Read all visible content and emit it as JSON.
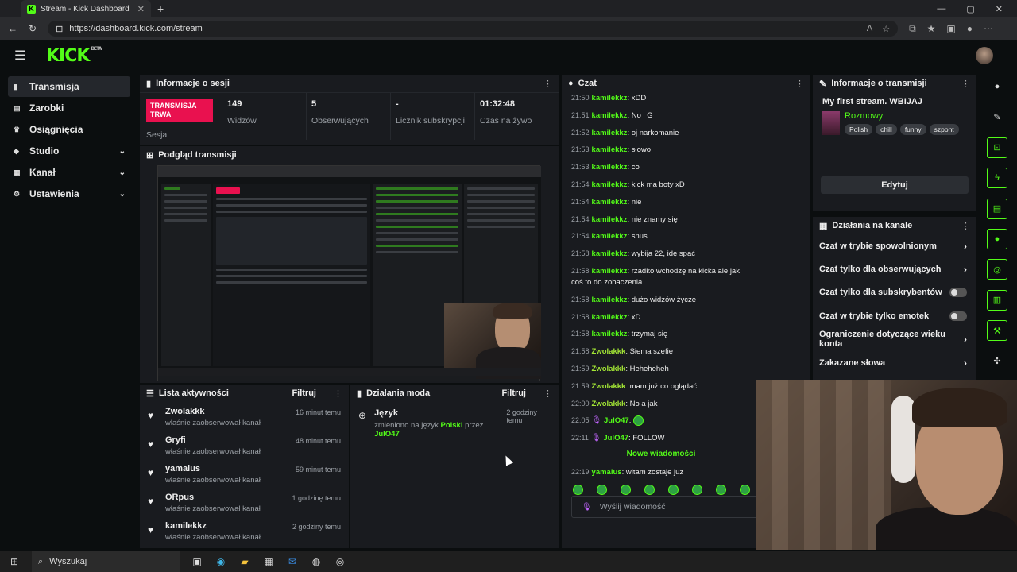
{
  "browser": {
    "tab_title": "Stream - Kick Dashboard",
    "url": "https://dashboard.kick.com/stream",
    "tab_logo": "K"
  },
  "site": {
    "logo": "KICK",
    "beta": "BETA"
  },
  "sidebar": {
    "items": [
      {
        "label": "Transmisja",
        "icon": "broadcast-icon",
        "active": true
      },
      {
        "label": "Zarobki",
        "icon": "earnings-icon"
      },
      {
        "label": "Osiągnięcia",
        "icon": "trophy-icon"
      },
      {
        "label": "Studio",
        "icon": "studio-icon",
        "chevron": true
      },
      {
        "label": "Kanał",
        "icon": "channel-icon",
        "chevron": true
      },
      {
        "label": "Ustawienia",
        "icon": "gear-icon",
        "chevron": true
      }
    ]
  },
  "session": {
    "title": "Informacje o sesji",
    "live_badge": "TRANSMISJA TRWA",
    "live_label": "Sesja",
    "stats": [
      {
        "value": "149",
        "label": "Widzów"
      },
      {
        "value": "5",
        "label": "Obserwujących"
      },
      {
        "value": "-",
        "label": "Licznik subskrypcji"
      },
      {
        "value": "01:32:48",
        "label": "Czas na żywo"
      }
    ]
  },
  "preview": {
    "title": "Podgląd transmisji"
  },
  "activity": {
    "title": "Lista aktywności",
    "filter": "Filtruj",
    "items": [
      {
        "name": "Zwolakkk",
        "desc": "właśnie zaobserwował kanał",
        "time": "16 minut temu"
      },
      {
        "name": "Gryfi",
        "desc": "właśnie zaobserwował kanał",
        "time": "48 minut temu"
      },
      {
        "name": "yamalus",
        "desc": "właśnie zaobserwował kanał",
        "time": "59 minut temu"
      },
      {
        "name": "ORpus",
        "desc": "właśnie zaobserwował kanał",
        "time": "1 godzinę temu"
      },
      {
        "name": "kamilekkz",
        "desc": "właśnie zaobserwował kanał",
        "time": "2 godziny temu"
      }
    ]
  },
  "mod": {
    "title": "Działania moda",
    "filter": "Filtruj",
    "items": [
      {
        "name": "Język",
        "desc_pre": "zmieniono na język",
        "lang": "Polski",
        "by": "przez",
        "user": "JulO47",
        "time": "2 godziny temu"
      }
    ]
  },
  "chat": {
    "title": "Czat",
    "messages": [
      {
        "time": "21:50",
        "user": "kamilekkz",
        "text": "xDD"
      },
      {
        "time": "21:51",
        "user": "kamilekkz",
        "text": "No i G"
      },
      {
        "time": "21:52",
        "user": "kamilekkz",
        "text": "oj narkomanie"
      },
      {
        "time": "21:53",
        "user": "kamilekkz",
        "text": "słowo"
      },
      {
        "time": "21:53",
        "user": "kamilekkz",
        "text": "co"
      },
      {
        "time": "21:54",
        "user": "kamilekkz",
        "text": "kick ma boty xD"
      },
      {
        "time": "21:54",
        "user": "kamilekkz",
        "text": "nie"
      },
      {
        "time": "21:54",
        "user": "kamilekkz",
        "text": "nie znamy się"
      },
      {
        "time": "21:54",
        "user": "kamilekkz",
        "text": "snus"
      },
      {
        "time": "21:58",
        "user": "kamilekkz",
        "text": "wybija 22, idę spać"
      },
      {
        "time": "21:58",
        "user": "kamilekkz",
        "text": "rzadko wchodzę na kicka ale jak coś to do zobaczenia"
      },
      {
        "time": "21:58",
        "user": "kamilekkz",
        "text": "dużo widzów życze"
      },
      {
        "time": "21:58",
        "user": "kamilekkz",
        "text": "xD"
      },
      {
        "time": "21:58",
        "user": "kamilekkz",
        "text": "trzymaj się"
      },
      {
        "time": "21:58",
        "user": "Zwolakkk",
        "text": "Siema szefie"
      },
      {
        "time": "21:59",
        "user": "Zwolakkk",
        "text": "Heheheheh"
      },
      {
        "time": "21:59",
        "user": "Zwolakkk",
        "text": "mam już co oglądać"
      },
      {
        "time": "22:00",
        "user": "Zwolakkk",
        "text": "No a jak"
      },
      {
        "time": "22:05",
        "user": "JulO47",
        "text": "",
        "mod": true
      },
      {
        "time": "22:11",
        "user": "JulO47",
        "text": "FOLLOW",
        "mod": true
      }
    ],
    "new_messages": "Nowe wiadomości",
    "last": {
      "time": "22:19",
      "user": "yamalus",
      "text": "witam zostaje juz"
    },
    "input_placeholder": "Wyślij wiadomość"
  },
  "stream_info": {
    "title": "Informacje o transmisji",
    "stream_title": "My first stream. WBIJAJ",
    "category": "Rozmowy",
    "tags": [
      "Polish",
      "chill",
      "funny",
      "szpont"
    ],
    "edit": "Edytuj"
  },
  "channel_actions": {
    "title": "Działania na kanale",
    "items": [
      {
        "label": "Czat w trybie spowolnionym",
        "type": "arrow"
      },
      {
        "label": "Czat tylko dla obserwujących",
        "type": "arrow"
      },
      {
        "label": "Czat tylko dla subskrybentów",
        "type": "toggle"
      },
      {
        "label": "Czat w trybie tylko emotek",
        "type": "toggle"
      },
      {
        "label": "Ograniczenie dotyczące wieku konta",
        "type": "arrow"
      },
      {
        "label": "Zakazane słowa",
        "type": "arrow"
      }
    ]
  },
  "taskbar": {
    "search": "Wyszukaj"
  }
}
